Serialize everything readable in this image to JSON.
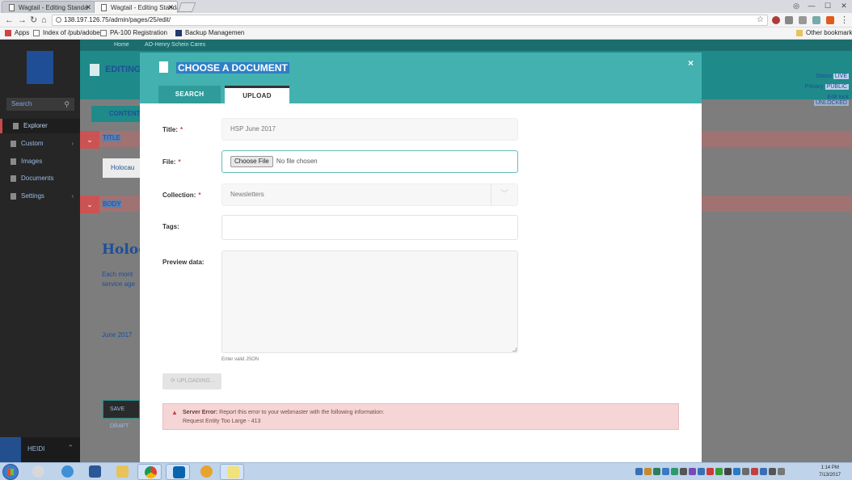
{
  "browser": {
    "tabs": [
      {
        "title": "Wagtail - Editing Standa",
        "active": false
      },
      {
        "title": "Wagtail - Editing Standa",
        "active": true
      }
    ],
    "url": "138.197.126.75/admin/pages/25/edit/",
    "bookmarks": [
      {
        "label": "Apps",
        "icon": "apps-grid-icon"
      },
      {
        "label": "Index of /pub/adobe",
        "icon": "page-icon"
      },
      {
        "label": "PA-100 Registration",
        "icon": "page-icon"
      },
      {
        "label": "Backup Managemen",
        "icon": "a-logo-icon"
      }
    ],
    "other_bookmarks": "Other bookmarks"
  },
  "wagtail": {
    "breadcrumbs": [
      "Home",
      "AO-Henry Schein Cares"
    ],
    "header_title": "EDITING",
    "status": {
      "status_label": "Status",
      "status_value": "LIVE",
      "privacy_label": "Privacy",
      "privacy_value": "PUBLIC",
      "edit_lock": "Edit lock",
      "lock_value": "UNLOCKED"
    },
    "content_tab": "CONTENT",
    "sidebar": {
      "search_placeholder": "Search",
      "items": [
        {
          "label": "Explorer",
          "active": true
        },
        {
          "label": "Custom",
          "submenu": true
        },
        {
          "label": "Images"
        },
        {
          "label": "Documents"
        },
        {
          "label": "Settings",
          "submenu": true
        }
      ],
      "user_name": "HEIDI"
    },
    "title_label": "TITLE",
    "title_value": "Holocau",
    "body_label": "BODY",
    "big_word": "Holoc",
    "body_lines": [
      "Each mont",
      "service age"
    ],
    "date_text": "June 2017",
    "save_draft": "SAVE DRAFT"
  },
  "modal": {
    "title": "CHOOSE A DOCUMENT",
    "close": "×",
    "tabs": {
      "search": "SEARCH",
      "upload": "UPLOAD"
    },
    "fields": {
      "title_label": "Title:",
      "title_value": "HSP June 2017",
      "file_label": "File:",
      "choose_file": "Choose File",
      "no_file": "No file chosen",
      "collection_label": "Collection:",
      "collection_value": "Newsletters",
      "tags_label": "Tags:",
      "preview_label": "Preview data:",
      "help_text": "Enter valid JSON",
      "required_mark": "*"
    },
    "upload_button": "UPLOADING...",
    "error": {
      "heading": "Server Error:",
      "message": "Report this error to your webmaster with the following information:",
      "detail": "Request Entity Too Large - 413"
    }
  },
  "taskbar": {
    "time": "1:14 PM",
    "date": "7/13/2017"
  },
  "colors": {
    "teal": "#43b1b0",
    "teal_dark": "#2f9c9a",
    "error_bg": "#f5d5d5",
    "highlight_blue": "#1d4f98"
  }
}
